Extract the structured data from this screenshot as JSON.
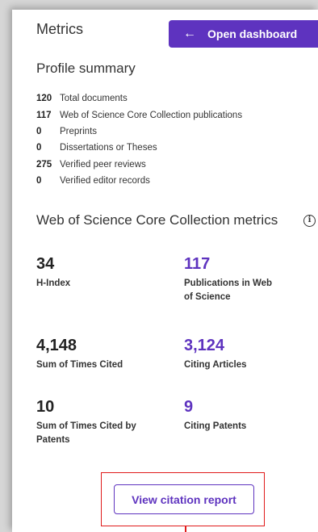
{
  "panel": {
    "title": "Metrics",
    "dashboard_button": {
      "icon": "arrow-left-icon",
      "arrow": "←",
      "label": "Open dashboard"
    }
  },
  "profile_summary": {
    "heading": "Profile summary",
    "items": [
      {
        "count": "120",
        "label": "Total documents"
      },
      {
        "count": "117",
        "label": "Web of Science Core Collection publications"
      },
      {
        "count": "0",
        "label": "Preprints"
      },
      {
        "count": "0",
        "label": "Dissertations or Theses"
      },
      {
        "count": "275",
        "label": "Verified peer reviews"
      },
      {
        "count": "0",
        "label": "Verified editor records"
      }
    ]
  },
  "core_metrics": {
    "heading": "Web of Science Core Collection metrics",
    "info_icon": "info-icon",
    "info_glyph": "i",
    "h_index": {
      "value": "34",
      "label": "H-Index"
    },
    "publications": {
      "value": "117",
      "label": "Publications in Web of Science"
    },
    "times_cited": {
      "value": "4,148",
      "label": "Sum of Times Cited"
    },
    "citing_articles": {
      "value": "3,124",
      "label": "Citing Articles"
    },
    "times_cited_patents": {
      "value": "10",
      "label": "Sum of Times Cited by Patents"
    },
    "citing_patents": {
      "value": "9",
      "label": "Citing Patents"
    }
  },
  "report_button": {
    "label": "View citation report"
  },
  "colors": {
    "accent": "#5e33bf",
    "highlight": "#e01b1b"
  }
}
